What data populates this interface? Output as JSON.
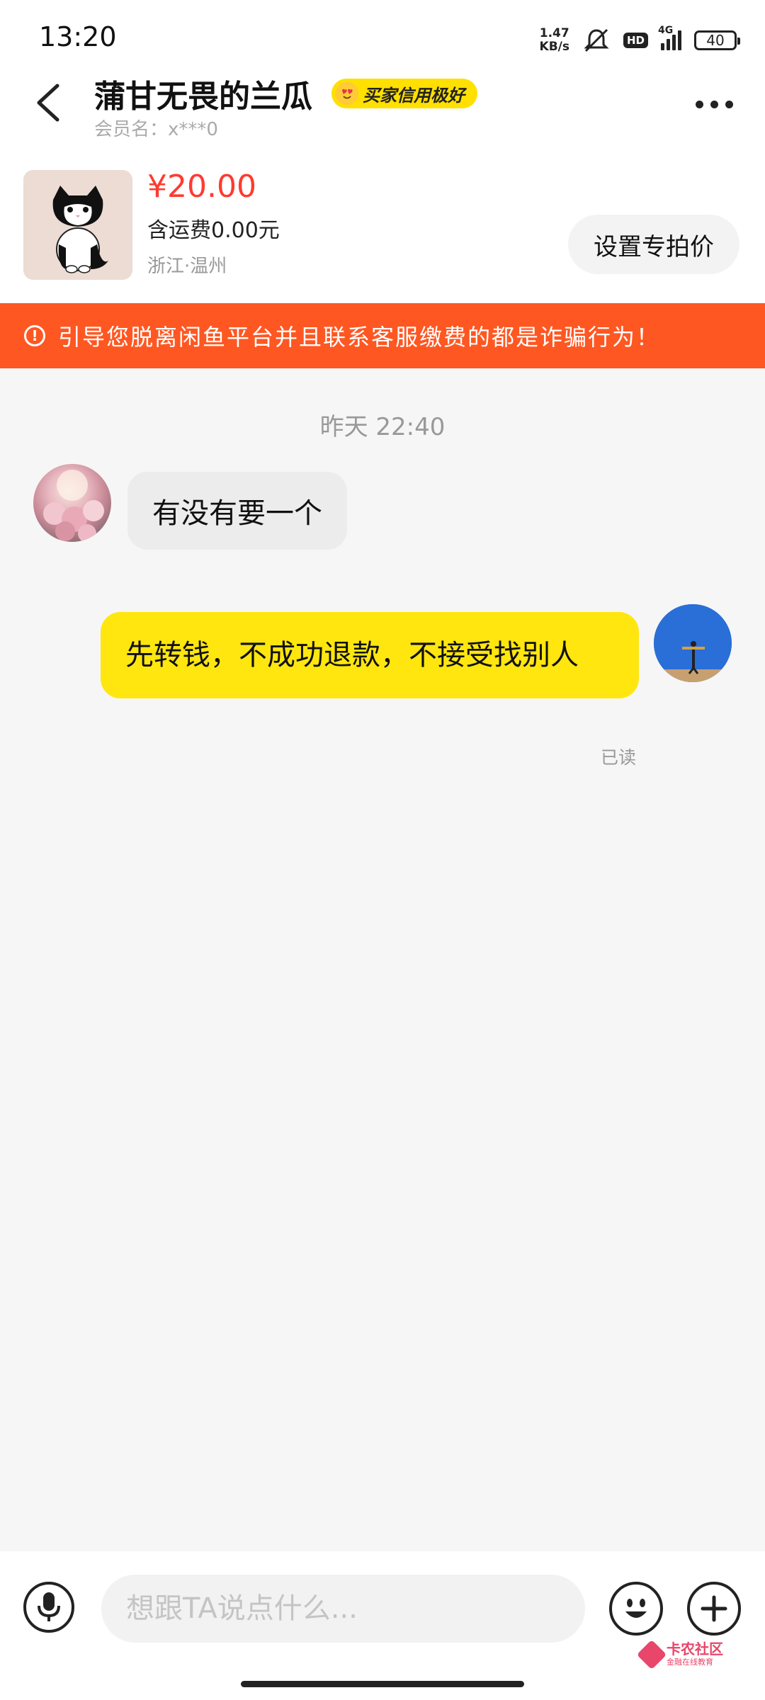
{
  "status_bar": {
    "time": "13:20",
    "net_speed_value": "1.47",
    "net_speed_unit": "KB/s",
    "hd": "HD",
    "network": "4G",
    "battery": "40"
  },
  "header": {
    "title": "蒲甘无畏的兰瓜",
    "badge": "买家信用极好",
    "member_label": "会员名：x***0"
  },
  "product": {
    "price": "¥20.00",
    "shipping": "含运费0.00元",
    "location": "浙江·温州",
    "special_price_button": "设置专拍价"
  },
  "warning": {
    "text": "引导您脱离闲鱼平台并且联系客服缴费的都是诈骗行为！"
  },
  "chat": {
    "timestamp": "昨天 22:40",
    "messages": [
      {
        "side": "left",
        "text": "有没有要一个"
      },
      {
        "side": "right",
        "text": "先转钱，不成功退款，不接受找别人",
        "status": "已读"
      }
    ]
  },
  "input": {
    "placeholder": "想跟TA说点什么..."
  },
  "watermark": {
    "title": "卡农社区",
    "subtitle": "金融在线教育"
  },
  "colors": {
    "price": "#ff3b30",
    "warning_bg": "#ff5722",
    "badge_bg": "#ffe000",
    "my_bubble": "#ffe60f"
  }
}
